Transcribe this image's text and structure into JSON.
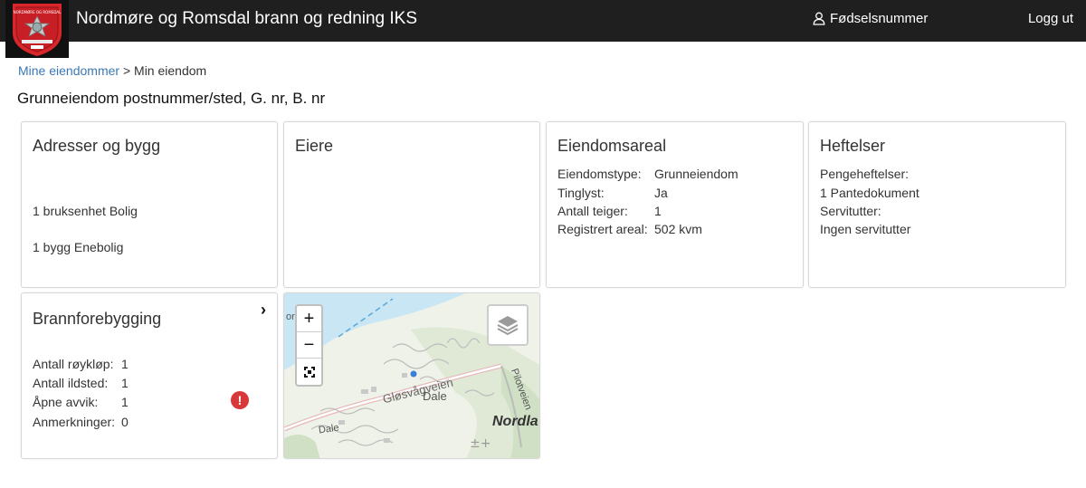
{
  "header": {
    "title": "Nordmøre og Romsdal brann og redning IKS",
    "user_label": "Fødselsnummer",
    "logout_label": "Logg ut",
    "background": "#1f1f1f"
  },
  "breadcrumb": {
    "parent": "Mine eiendommer",
    "separator": ">",
    "current": "Min eiendom"
  },
  "page_title": "Grunneiendom postnummer/sted, G. nr, B. nr",
  "cards": {
    "addresses": {
      "title": "Adresser og bygg",
      "lines": [
        "1 bruksenhet Bolig",
        "1 bygg Enebolig"
      ]
    },
    "owners": {
      "title": "Eiere"
    },
    "property_area": {
      "title": "Eiendomsareal",
      "rows": [
        {
          "label": "Eiendomstype:",
          "value": "Grunneiendom"
        },
        {
          "label": "Tinglyst:",
          "value": "Ja"
        },
        {
          "label": "Antall teiger:",
          "value": "1"
        },
        {
          "label": "Registrert areal:",
          "value": "502 kvm"
        }
      ]
    },
    "encumbrances": {
      "title": "Heftelser",
      "lines": [
        "Pengeheftelser:",
        "1 Pantedokument",
        "Servitutter:",
        "Ingen servitutter"
      ]
    },
    "fire_prevention": {
      "title": "Brannforebygging",
      "chevron": "›",
      "rows": [
        {
          "label": "Antall røykløp:",
          "value": "1"
        },
        {
          "label": "Antall ildsted:",
          "value": "1"
        },
        {
          "label": "Åpne avvik:",
          "value": "1"
        },
        {
          "label": "Anmerkninger:",
          "value": "0"
        }
      ],
      "alert_symbol": "!",
      "alert_color": "#d9383a"
    }
  },
  "map": {
    "zoom_in": "+",
    "zoom_out": "−",
    "labels": {
      "road": "Gløsvågveien",
      "area1": "Dale",
      "area2": "Dale",
      "area3": "Nordla",
      "road2": "Pilotveien",
      "edge": "orp"
    },
    "water_color": "#c9e6f5",
    "land_color": "#eef2e8"
  },
  "colors": {
    "link": "#3a78b5",
    "alert": "#d9383a"
  }
}
